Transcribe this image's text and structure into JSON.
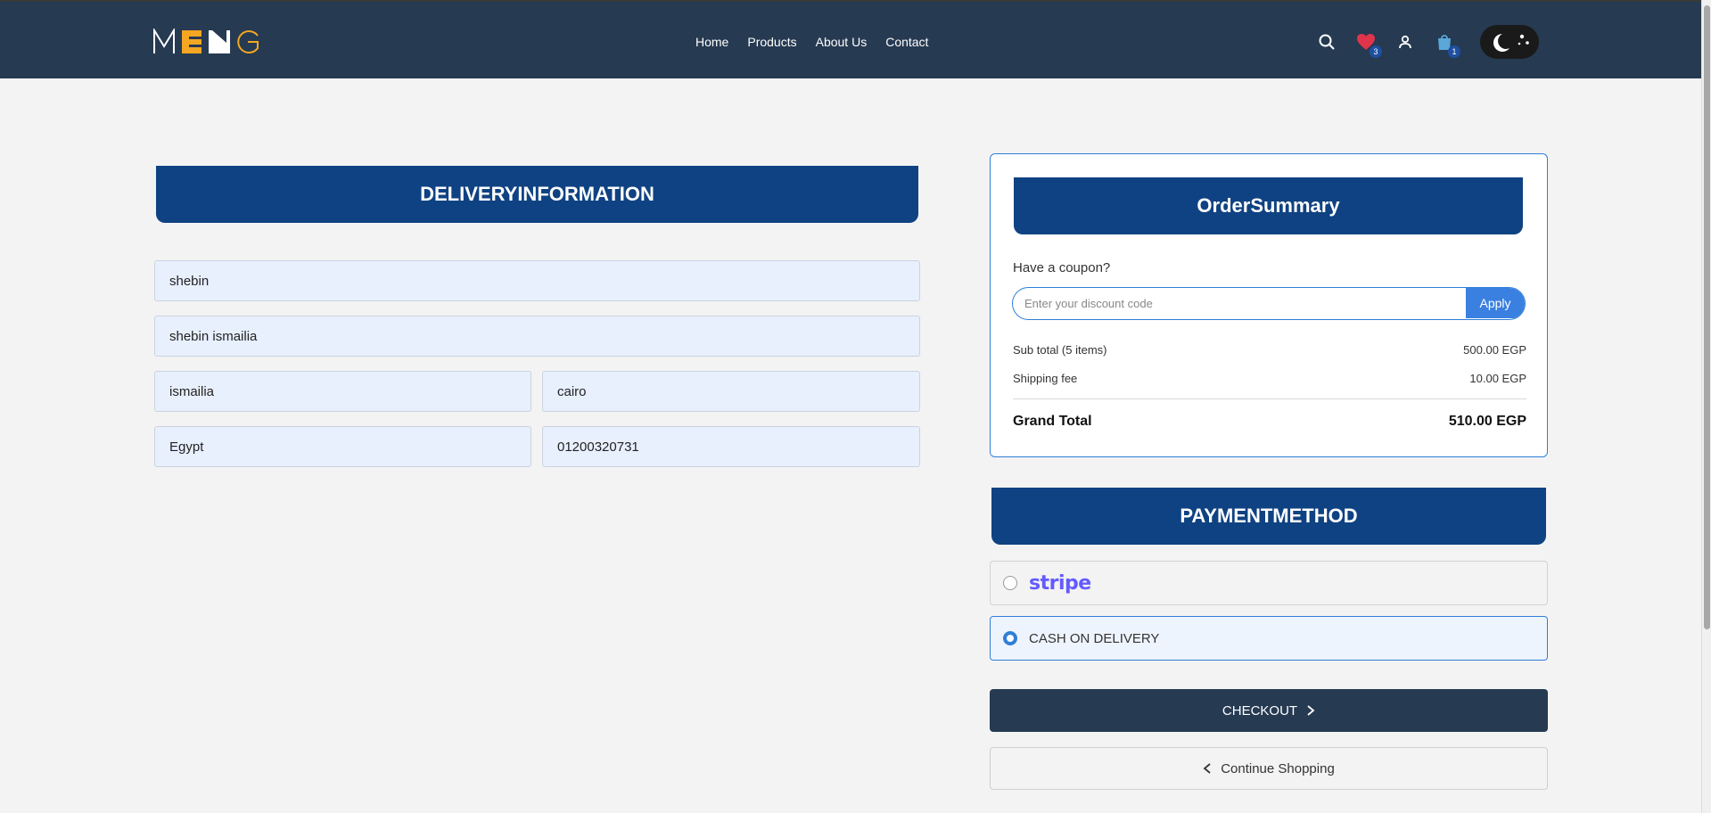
{
  "nav": {
    "links": [
      "Home",
      "Products",
      "About Us",
      "Contact"
    ],
    "wishlist_count": "3",
    "cart_count": "1"
  },
  "delivery": {
    "title": "DELIVERYINFORMATION",
    "name": "shebin",
    "address": "shebin ismailia",
    "city": "ismailia",
    "region": "cairo",
    "country": "Egypt",
    "phone": "01200320731"
  },
  "summary": {
    "title": "OrderSummary",
    "coupon_label": "Have a coupon?",
    "coupon_placeholder": "Enter your discount code",
    "apply_label": "Apply",
    "subtotal_label": "Sub total (5 items)",
    "subtotal_value": "500.00 EGP",
    "shipping_label": "Shipping fee",
    "shipping_value": "10.00 EGP",
    "grand_label": "Grand Total",
    "grand_value": "510.00 EGP"
  },
  "payment": {
    "title": "PAYMENTMETHOD",
    "stripe_label": "stripe",
    "cod_label": "CASH ON DELIVERY",
    "selected": "cod"
  },
  "actions": {
    "checkout_label": "CHECKOUT",
    "continue_label": "Continue Shopping"
  },
  "colors": {
    "navbar": "#263a52",
    "header_blue": "#0f4282",
    "accent": "#2f7fd8",
    "logo_orange": "#f5a623"
  }
}
